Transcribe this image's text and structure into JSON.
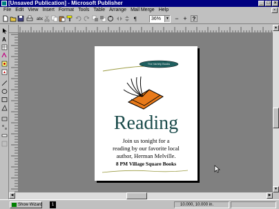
{
  "window": {
    "title": "[Unsaved Publication] - Microsoft Publisher"
  },
  "menu": {
    "items": [
      {
        "label": "File"
      },
      {
        "label": "Edit"
      },
      {
        "label": "View"
      },
      {
        "label": "Insert"
      },
      {
        "label": "Format"
      },
      {
        "label": "Tools"
      },
      {
        "label": "Table"
      },
      {
        "label": "Arrange"
      },
      {
        "label": "Mail Merge"
      },
      {
        "label": "Help"
      }
    ]
  },
  "toolbar": {
    "zoom_value": "36%",
    "zoom_out_label": "−",
    "zoom_in_label": "+",
    "help_label": "?",
    "paragraph_label": "¶"
  },
  "publication": {
    "banner_text": "The Variety Books",
    "headline": "Reading",
    "body_lines": [
      "Join us tonight for a",
      "reading by our favorite local",
      "author, Herman Melville."
    ],
    "footer": "8 PM Village Square Books"
  },
  "statusbar": {
    "show_wizard_label": "Show Wizard",
    "page_number": "1",
    "coordinates": "10.000, 10.000 in."
  },
  "colors": {
    "title_bar": "#000080",
    "book_cover": "#e87a1a",
    "banner_fill": "#1f5f5f",
    "headline": "#1a4a4a"
  }
}
